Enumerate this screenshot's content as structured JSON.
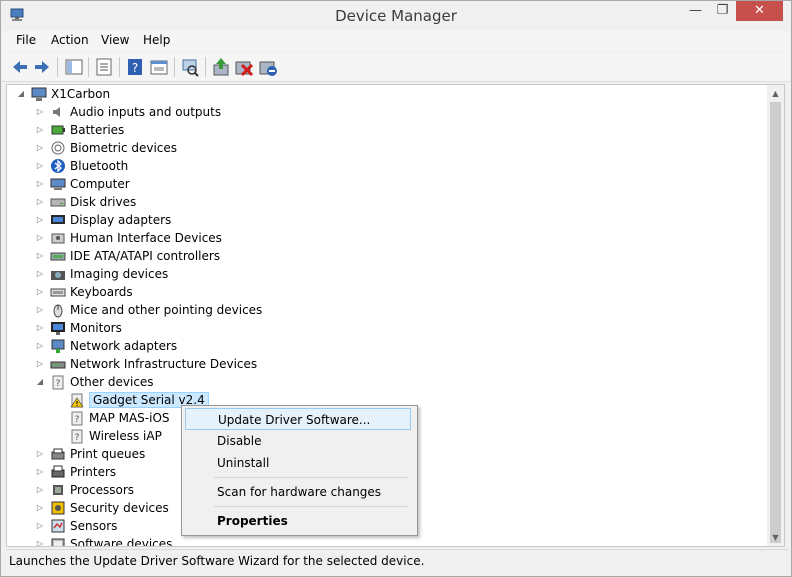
{
  "window": {
    "title": "Device Manager"
  },
  "title_buttons": {
    "minimize": "—",
    "maximize": "❐",
    "close": "✕"
  },
  "menu": [
    "File",
    "Action",
    "View",
    "Help"
  ],
  "toolbar": {
    "icons": [
      "back-icon",
      "forward-icon",
      "tree-view-icon",
      "properties-icon",
      "help-icon",
      "show-hide-icon",
      "scan-hardware-icon",
      "update-driver-icon",
      "uninstall-icon",
      "disable-icon"
    ]
  },
  "tree": {
    "root": "X1Carbon",
    "categories": [
      {
        "label": "Audio inputs and outputs",
        "icon": "speaker-icon"
      },
      {
        "label": "Batteries",
        "icon": "battery-icon"
      },
      {
        "label": "Biometric devices",
        "icon": "fingerprint-icon"
      },
      {
        "label": "Bluetooth",
        "icon": "bluetooth-icon"
      },
      {
        "label": "Computer",
        "icon": "computer-icon"
      },
      {
        "label": "Disk drives",
        "icon": "disk-drive-icon"
      },
      {
        "label": "Display adapters",
        "icon": "display-adapter-icon"
      },
      {
        "label": "Human Interface Devices",
        "icon": "hid-icon"
      },
      {
        "label": "IDE ATA/ATAPI controllers",
        "icon": "ide-controller-icon"
      },
      {
        "label": "Imaging devices",
        "icon": "camera-icon"
      },
      {
        "label": "Keyboards",
        "icon": "keyboard-icon"
      },
      {
        "label": "Mice and other pointing devices",
        "icon": "mouse-icon"
      },
      {
        "label": "Monitors",
        "icon": "monitor-icon"
      },
      {
        "label": "Network adapters",
        "icon": "network-adapter-icon"
      },
      {
        "label": "Network Infrastructure Devices",
        "icon": "network-infrastructure-icon"
      },
      {
        "label": "Other devices",
        "icon": "unknown-device-icon"
      }
    ],
    "other_devices_children": [
      {
        "label": "Gadget Serial v2.4",
        "icon": "warning-device-icon"
      },
      {
        "label": "MAP MAS-iOS",
        "icon": "unknown-device-icon"
      },
      {
        "label": "Wireless iAP",
        "icon": "unknown-device-icon"
      }
    ],
    "categories_after": [
      {
        "label": "Print queues",
        "icon": "print-queue-icon"
      },
      {
        "label": "Printers",
        "icon": "printer-icon"
      },
      {
        "label": "Processors",
        "icon": "processor-icon"
      },
      {
        "label": "Security devices",
        "icon": "security-icon"
      },
      {
        "label": "Sensors",
        "icon": "sensor-icon"
      },
      {
        "label": "Software devices",
        "icon": "software-device-icon"
      }
    ]
  },
  "context_menu": {
    "update": "Update Driver Software...",
    "disable": "Disable",
    "uninstall": "Uninstall",
    "scan": "Scan for hardware changes",
    "properties": "Properties"
  },
  "status": "Launches the Update Driver Software Wizard for the selected device.",
  "colors": {
    "selection": "#cce8ff",
    "close_button": "#c7504c",
    "menu_highlight": "#e5f1fb"
  }
}
